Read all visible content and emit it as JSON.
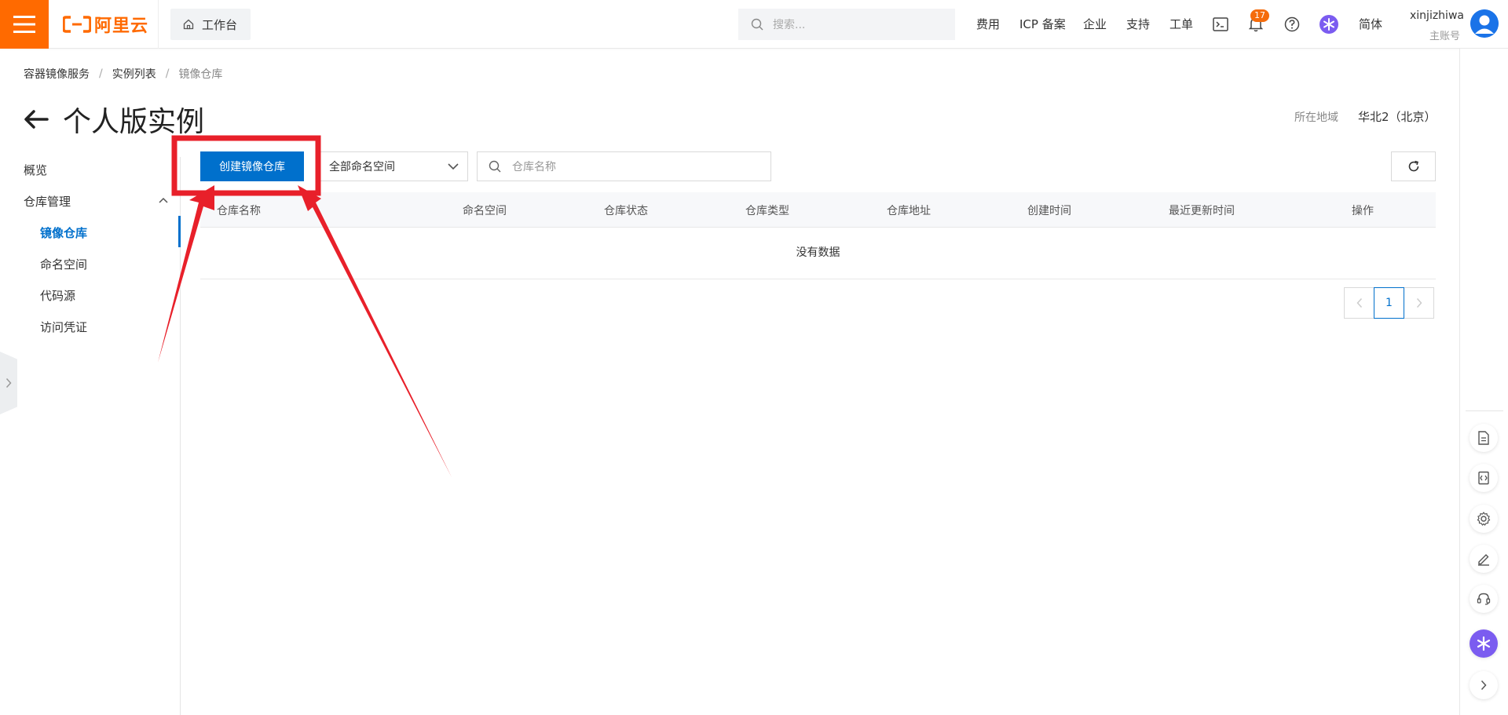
{
  "header": {
    "logo_text": "阿里云",
    "workbench_label": "工作台",
    "search_placeholder": "搜索...",
    "links": {
      "fees": "费用",
      "icp": "ICP 备案",
      "enterprise": "企业",
      "support": "支持",
      "ticket": "工单",
      "language": "简体"
    },
    "notification_count": "17",
    "user": {
      "name": "xinjizhiwa",
      "account_type": "主账号"
    },
    "brand_color": "#ff6a00"
  },
  "breadcrumb": {
    "items": [
      "容器镜像服务",
      "实例列表",
      "镜像仓库"
    ],
    "separator": "/"
  },
  "page": {
    "title": "个人版实例",
    "region_label": "所在地域",
    "region_value": "华北2（北京）"
  },
  "sidebar": {
    "overview": "概览",
    "group_label": "仓库管理",
    "items": [
      {
        "label": "镜像仓库",
        "active": true
      },
      {
        "label": "命名空间",
        "active": false
      },
      {
        "label": "代码源",
        "active": false
      },
      {
        "label": "访问凭证",
        "active": false
      }
    ]
  },
  "toolbar": {
    "create_button": "创建镜像仓库",
    "namespace_select": "全部命名空间",
    "search_placeholder": "仓库名称"
  },
  "table": {
    "columns": [
      "仓库名称",
      "命名空间",
      "仓库状态",
      "仓库类型",
      "仓库地址",
      "创建时间",
      "最近更新时间",
      "操作"
    ],
    "empty_text": "没有数据"
  },
  "pagination": {
    "current_page": "1"
  },
  "colors": {
    "primary": "#0070cc",
    "annotation": "#e8202a"
  }
}
